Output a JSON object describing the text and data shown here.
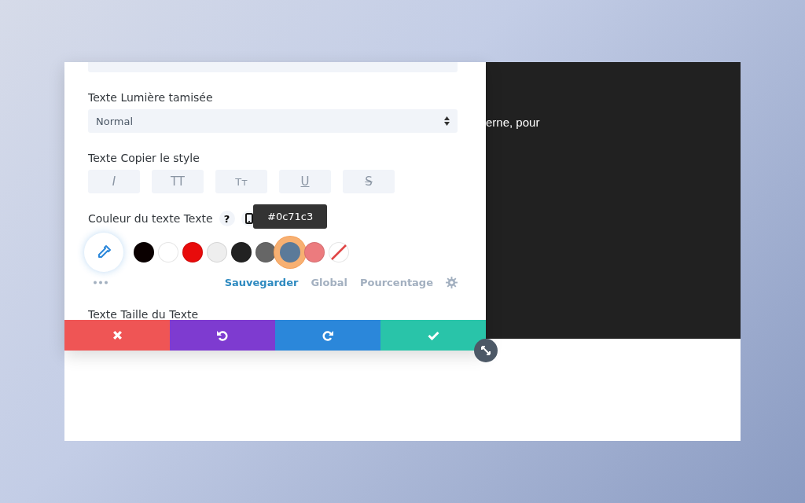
{
  "preview": {
    "text": "erne, pour"
  },
  "fields": [
    {
      "label": "Texte Lumière tamisée",
      "value": "Normal"
    }
  ],
  "style_group": {
    "label": "Texte Copier le style",
    "buttons": [
      {
        "kind": "italic",
        "label": "I",
        "selected": false
      },
      {
        "kind": "uppercase",
        "label": "TT",
        "selected": false
      },
      {
        "kind": "smallcaps",
        "label": "Tт",
        "selected": false
      },
      {
        "kind": "underline",
        "label": "U",
        "selected": false
      },
      {
        "kind": "strike",
        "label": "S",
        "selected": false
      }
    ]
  },
  "color_group": {
    "label": "Couleur du texte Texte",
    "help": "?",
    "tooltip": "#0c71c3",
    "swatches": [
      {
        "color": "#0a0000",
        "selected": false
      },
      {
        "color": "#ffffff",
        "selected": false
      },
      {
        "color": "#e80b0b",
        "selected": false
      },
      {
        "color": "#eeeeee",
        "selected": false
      },
      {
        "color": "#222222",
        "selected": false
      },
      {
        "color": "#666666",
        "selected": false
      },
      {
        "color": "#5b7a99",
        "selected": true
      },
      {
        "color": "#ec7b7e",
        "selected": false
      },
      {
        "color": "#ffffff",
        "kind": "none",
        "selected": false
      }
    ],
    "tabs": [
      {
        "label": "Sauvegarder",
        "selected": true
      },
      {
        "label": "Global",
        "selected": false
      },
      {
        "label": "Pourcentage",
        "selected": false
      }
    ]
  },
  "next_label": "Texte Taille du Texte",
  "actions": [
    {
      "kind": "cancel"
    },
    {
      "kind": "undo"
    },
    {
      "kind": "redo"
    },
    {
      "kind": "save"
    }
  ]
}
